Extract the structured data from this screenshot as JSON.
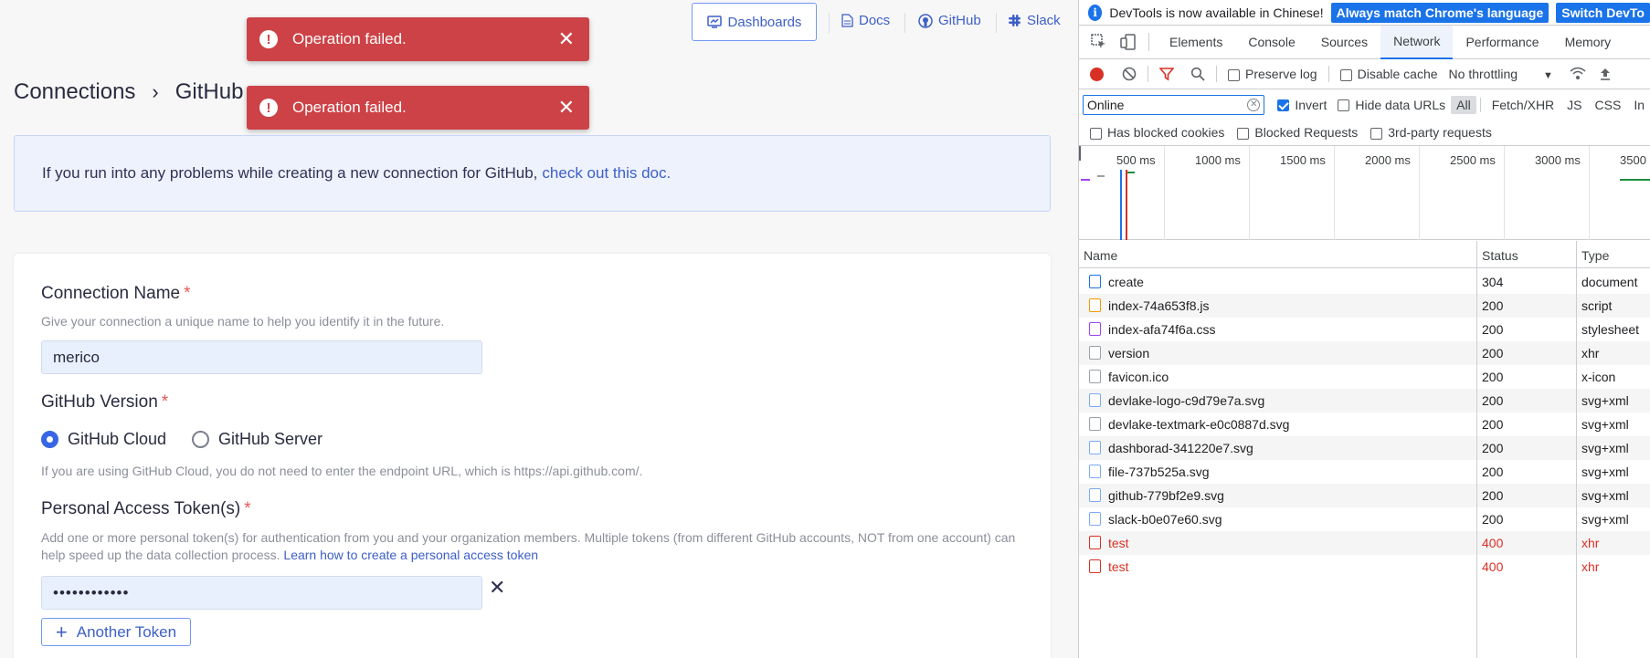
{
  "app": {
    "nav": {
      "dashboards": "Dashboards",
      "docs": "Docs",
      "github": "GitHub",
      "slack": "Slack"
    },
    "breadcrumb": {
      "root": "Connections",
      "current": "GitHub"
    },
    "toasts": [
      {
        "message": "Operation failed."
      },
      {
        "message": "Operation failed."
      }
    ],
    "info": {
      "text": "If you run into any problems while creating a new connection for GitHub,",
      "link": "check out this doc."
    },
    "form": {
      "name_label": "Connection Name",
      "name_hint": "Give your connection a unique name to help you identify it in the future.",
      "name_value": "merico",
      "version_label": "GitHub Version",
      "version_cloud": "GitHub Cloud",
      "version_server": "GitHub Server",
      "version_selected": "GitHub Cloud",
      "version_hint": "If you are using GitHub Cloud, you do not need to enter the endpoint URL, which is https://api.github.com/.",
      "token_label": "Personal Access Token(s)",
      "token_hint": "Add one or more personal token(s) for authentication from you and your organization members. Multiple tokens (from different GitHub accounts, NOT from one account) can help speed up the data collection process.",
      "token_hint_link": "Learn how to create a personal access token",
      "token_value": "••••••••••••",
      "another_token": "Another Token",
      "required_mark": "*"
    }
  },
  "devtools": {
    "banner": {
      "text": "DevTools is now available in Chinese!",
      "btn_match": "Always match Chrome's language",
      "btn_switch": "Switch DevTo"
    },
    "tabs": [
      "Elements",
      "Console",
      "Sources",
      "Network",
      "Performance",
      "Memory"
    ],
    "active_tab": "Network",
    "toolbar": {
      "preserve_log": "Preserve log",
      "disable_cache": "Disable cache",
      "throttling": "No throttling"
    },
    "filter": {
      "value": "Online",
      "invert": "Invert",
      "hide_data_urls": "Hide data URLs",
      "types": [
        "All",
        "Fetch/XHR",
        "JS",
        "CSS",
        "In"
      ],
      "active_type": "All"
    },
    "blocked": {
      "has_blocked_cookies": "Has blocked cookies",
      "blocked_requests": "Blocked Requests",
      "third_party": "3rd-party requests"
    },
    "timeline_ticks": [
      "500 ms",
      "1000 ms",
      "1500 ms",
      "2000 ms",
      "2500 ms",
      "3000 ms",
      "3500"
    ],
    "columns": {
      "name": "Name",
      "status": "Status",
      "type": "Type"
    },
    "requests": [
      {
        "name": "create",
        "status": "304",
        "type": "document",
        "icon": "doc",
        "error": false
      },
      {
        "name": "index-74a653f8.js",
        "status": "200",
        "type": "script",
        "icon": "js",
        "error": false
      },
      {
        "name": "index-afa74f6a.css",
        "status": "200",
        "type": "stylesheet",
        "icon": "css",
        "error": false
      },
      {
        "name": "version",
        "status": "200",
        "type": "xhr",
        "icon": "plain",
        "error": false
      },
      {
        "name": "favicon.ico",
        "status": "200",
        "type": "x-icon",
        "icon": "plain",
        "error": false
      },
      {
        "name": "devlake-logo-c9d79e7a.svg",
        "status": "200",
        "type": "svg+xml",
        "icon": "img",
        "error": false
      },
      {
        "name": "devlake-textmark-e0c0887d.svg",
        "status": "200",
        "type": "svg+xml",
        "icon": "plain",
        "error": false
      },
      {
        "name": "dashborad-341220e7.svg",
        "status": "200",
        "type": "svg+xml",
        "icon": "img",
        "error": false
      },
      {
        "name": "file-737b525a.svg",
        "status": "200",
        "type": "svg+xml",
        "icon": "img",
        "error": false
      },
      {
        "name": "github-779bf2e9.svg",
        "status": "200",
        "type": "svg+xml",
        "icon": "img",
        "error": false
      },
      {
        "name": "slack-b0e07e60.svg",
        "status": "200",
        "type": "svg+xml",
        "icon": "img",
        "error": false
      },
      {
        "name": "test",
        "status": "400",
        "type": "xhr",
        "icon": "err",
        "error": true
      },
      {
        "name": "test",
        "status": "400",
        "type": "xhr",
        "icon": "err",
        "error": true
      }
    ]
  }
}
